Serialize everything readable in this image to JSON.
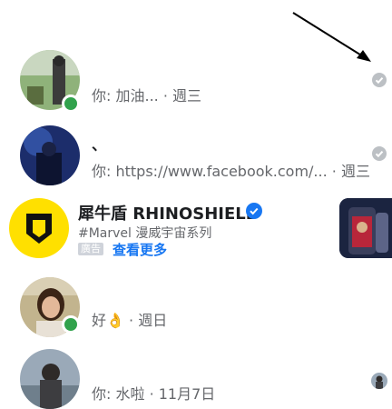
{
  "conversations": [
    {
      "preview": "你: 加油...",
      "time": "· 週三",
      "status": "read",
      "online": true
    },
    {
      "name": "、",
      "preview": "你: https://www.facebook.com/...",
      "time": "· 週三",
      "status": "read",
      "online": false
    },
    {
      "name": "犀牛盾 RHINOSHIELD",
      "subtitle": "#Marvel 漫威宇宙系列",
      "ad_tag": "廣告",
      "cta": "查看更多",
      "verified": true
    },
    {
      "preview": "好",
      "emoji": "👌",
      "time": "· 週日",
      "status": "none",
      "online": true
    },
    {
      "preview": "你: 水啦",
      "time": "· 11月7日",
      "status": "seen-avatar",
      "online": false
    }
  ],
  "colors": {
    "online": "#31a24c",
    "link": "#1877f2",
    "muted": "#65676b",
    "read_check": "#bcc0c4"
  }
}
